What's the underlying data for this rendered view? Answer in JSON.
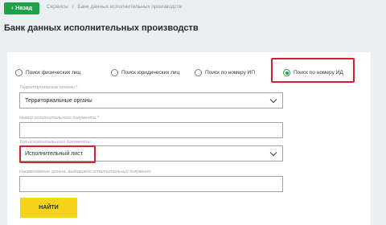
{
  "topbar": {
    "back_label": "Назад",
    "breadcrumbs": [
      "Сервисы",
      "Банк данных исполнительных производств"
    ]
  },
  "page_title": "Банк данных исполнительных производств",
  "search_types": {
    "options": [
      {
        "label": "Поиск физических лиц",
        "selected": false
      },
      {
        "label": "Поиск юридических лиц",
        "selected": false
      },
      {
        "label": "Поиск по номеру ИП",
        "selected": false
      },
      {
        "label": "Поиск по номеру ИД",
        "selected": true
      }
    ]
  },
  "form": {
    "territorial": {
      "label": "Территориальные органы:*",
      "value": "Территориальные органы"
    },
    "doc_number": {
      "label": "Номер исполнительного документа:*",
      "value": ""
    },
    "doc_type": {
      "label": "Тип исполнительного документа:",
      "value": "Исполнительный лист"
    },
    "issuer": {
      "label": "Наименование органа, выдавшего исполнительный документ:",
      "value": ""
    },
    "search_label": "НАЙТИ"
  },
  "colors": {
    "accent_green": "#1fa14a",
    "highlight_red": "#d3202a",
    "button_yellow": "#f6d31b"
  }
}
